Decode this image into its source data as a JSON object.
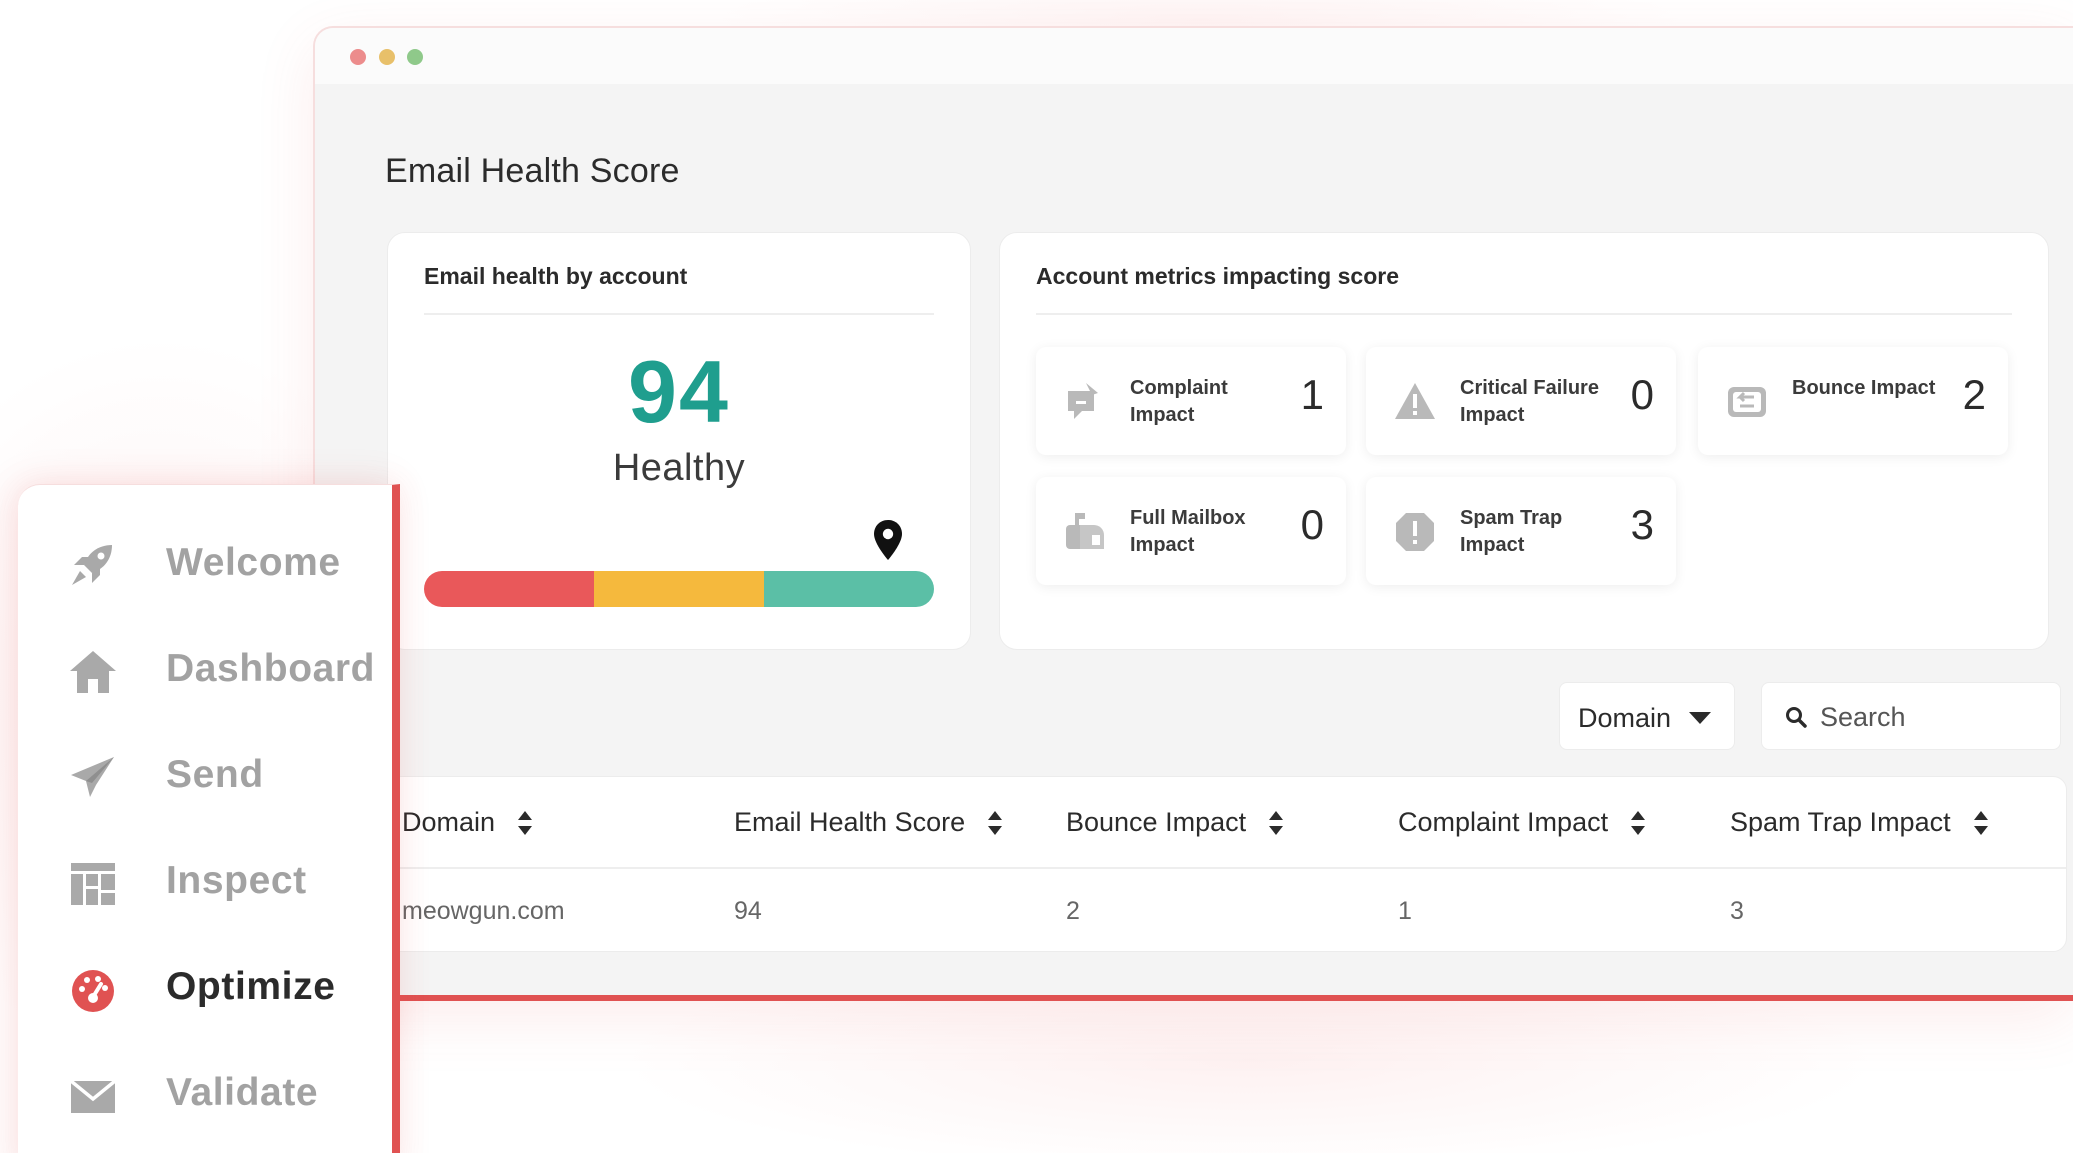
{
  "window": {
    "traffic_lights": [
      "close",
      "minimize",
      "maximize"
    ]
  },
  "page": {
    "title": "Email Health Score"
  },
  "health_card": {
    "title": "Email health by account",
    "score": "94",
    "status": "Healthy",
    "gauge_position": 0.91,
    "colors": {
      "score": "#1f9e8e",
      "gauge_low": "#e9585a",
      "gauge_mid": "#f5b93d",
      "gauge_high": "#5bbfa6"
    }
  },
  "metrics_card": {
    "title": "Account metrics impacting score",
    "metrics": [
      {
        "label": "Complaint Impact",
        "value": "1",
        "icon": "complaint-icon"
      },
      {
        "label": "Critical Failure Impact",
        "value": "0",
        "icon": "warning-icon"
      },
      {
        "label": "Bounce Impact",
        "value": "2",
        "icon": "bounce-icon"
      },
      {
        "label": "Full Mailbox Impact",
        "value": "0",
        "icon": "mailbox-icon"
      },
      {
        "label": "Spam Trap Impact",
        "value": "3",
        "icon": "spam-trap-icon"
      }
    ]
  },
  "filters": {
    "select_value": "Domain",
    "search_placeholder": "Search"
  },
  "table": {
    "columns": [
      "Domain",
      "Email Health Score",
      "Bounce Impact",
      "Complaint Impact",
      "Spam Trap Impact"
    ],
    "rows": [
      [
        "meowgun.com",
        "94",
        "2",
        "1",
        "3"
      ]
    ]
  },
  "sidebar": {
    "items": [
      {
        "label": "Welcome",
        "icon": "rocket-icon",
        "active": false
      },
      {
        "label": "Dashboard",
        "icon": "home-icon",
        "active": false
      },
      {
        "label": "Send",
        "icon": "paper-plane-icon",
        "active": false
      },
      {
        "label": "Inspect",
        "icon": "layout-icon",
        "active": false
      },
      {
        "label": "Optimize",
        "icon": "gauge-icon",
        "active": true
      },
      {
        "label": "Validate",
        "icon": "envelope-icon",
        "active": false
      }
    ],
    "accent_color": "#e05252"
  }
}
